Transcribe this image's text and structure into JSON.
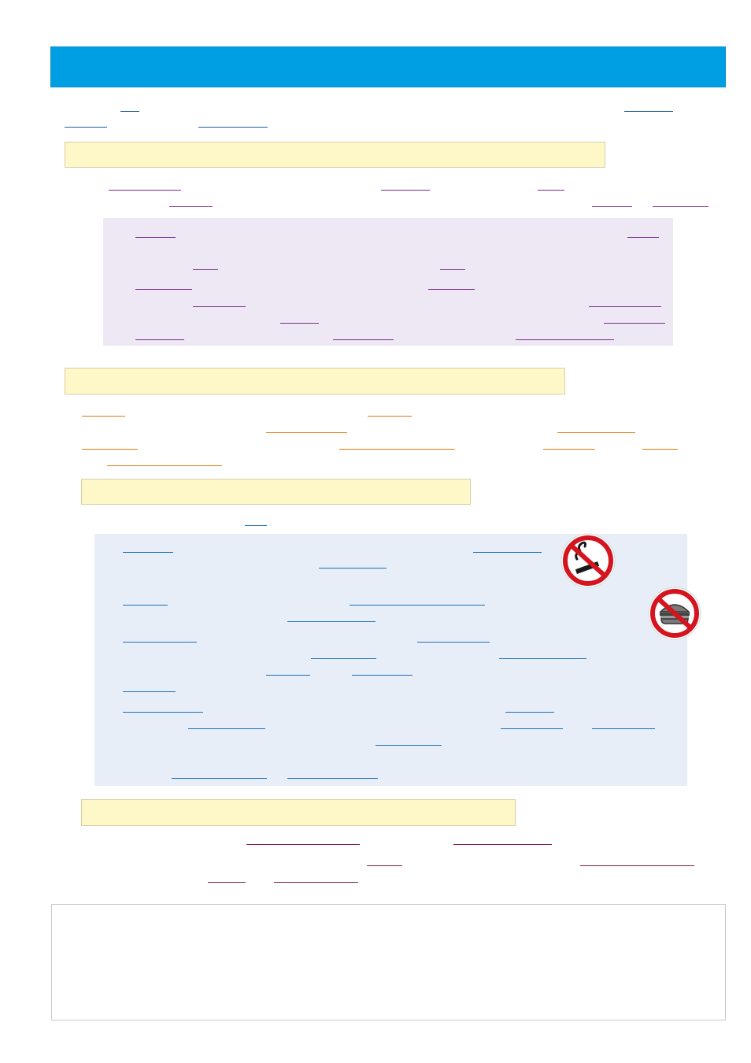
{
  "colors": {
    "banner": "#009fe3",
    "section_bar": "#fef8c8",
    "panel_purple": "#eee8f4",
    "panel_blue": "#e8eef8",
    "link_blue": "#1d5fa4",
    "link_purple": "#7b2d8e",
    "link_orange": "#e07a12",
    "link_maroon": "#8a1c4e",
    "sign_red": "#d4141e"
  },
  "icons": {
    "no_smoking": "no-smoking-icon",
    "no_food": "no-food-icon"
  }
}
